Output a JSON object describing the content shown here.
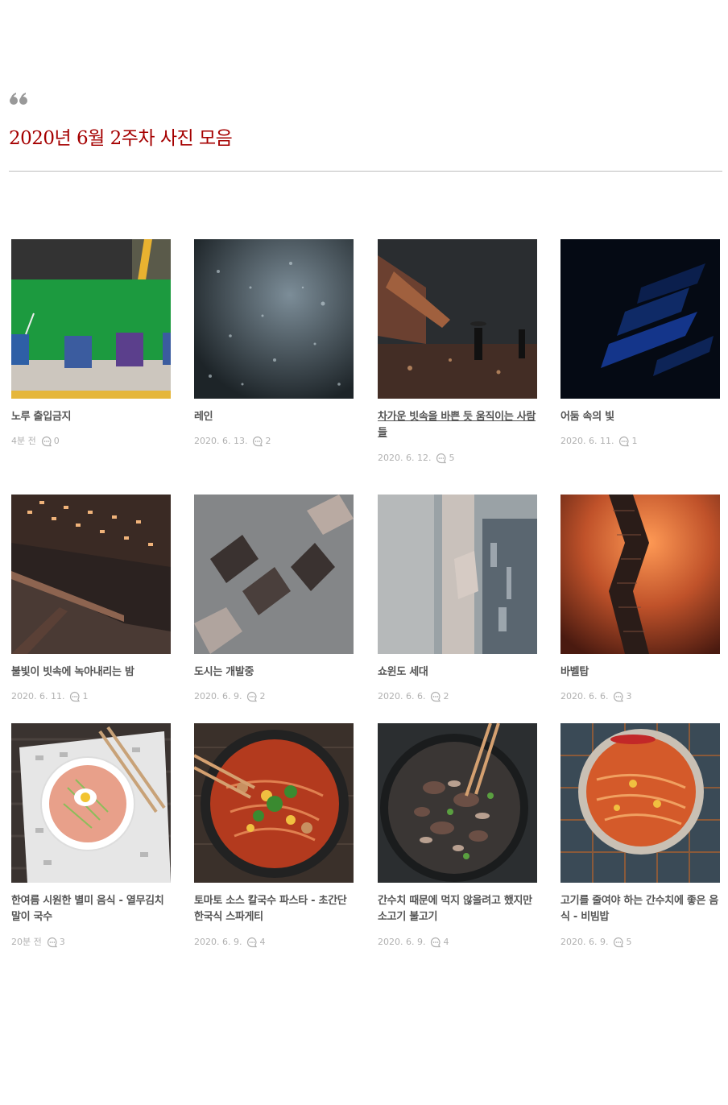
{
  "header": {
    "title": "2020년 6월 2주차 사진 모음"
  },
  "posts": [
    {
      "title": "노루 출입금지",
      "date": "4분 전",
      "comments": "0",
      "image": "parking-lot-paint-cans"
    },
    {
      "title": "레인",
      "date": "2020. 6. 13.",
      "comments": "2",
      "image": "rain-drops-window"
    },
    {
      "title": "차가운 빗속을 바쁜 듯 움직이는 사람들",
      "date": "2020. 6. 12.",
      "comments": "5",
      "image": "rainy-street-bridge"
    },
    {
      "title": "어둠 속의 빛",
      "date": "2020. 6. 11.",
      "comments": "1",
      "image": "dark-blue-light"
    },
    {
      "title": "불빛이 빗속에 녹아내리는 밤",
      "date": "2020. 6. 11.",
      "comments": "1",
      "image": "night-lights-ceiling"
    },
    {
      "title": "도시는 개발중",
      "date": "2020. 6. 9.",
      "comments": "2",
      "image": "city-buildings-kaleidoscope"
    },
    {
      "title": "쇼윈도 세대",
      "date": "2020. 6. 6.",
      "comments": "2",
      "image": "blurred-shop-window"
    },
    {
      "title": "바벨탑",
      "date": "2020. 6. 6.",
      "comments": "3",
      "image": "tower-orange-sky"
    },
    {
      "title": "한여름 시원한 별미 음식 - 열무김치말이 국수",
      "date": "20분 전",
      "comments": "3",
      "image": "cold-noodle-bowl"
    },
    {
      "title": "토마토 소스 칼국수 파스타 - 초간단 한국식 스파게티",
      "date": "2020. 6. 9.",
      "comments": "4",
      "image": "tomato-noodle-pan"
    },
    {
      "title": "간수치 때문에 먹지 않을려고 했지만 소고기 불고기",
      "date": "2020. 6. 9.",
      "comments": "4",
      "image": "beef-bulgogi-pan"
    },
    {
      "title": "고기를 줄여야 하는 간수치에 좋은 음식 - 비빔밥",
      "date": "2020. 6. 9.",
      "comments": "5",
      "image": "bibimbap-bowl"
    }
  ],
  "colors": {
    "title": "#a50000",
    "meta": "#b0b0b0",
    "text": "#555555"
  }
}
